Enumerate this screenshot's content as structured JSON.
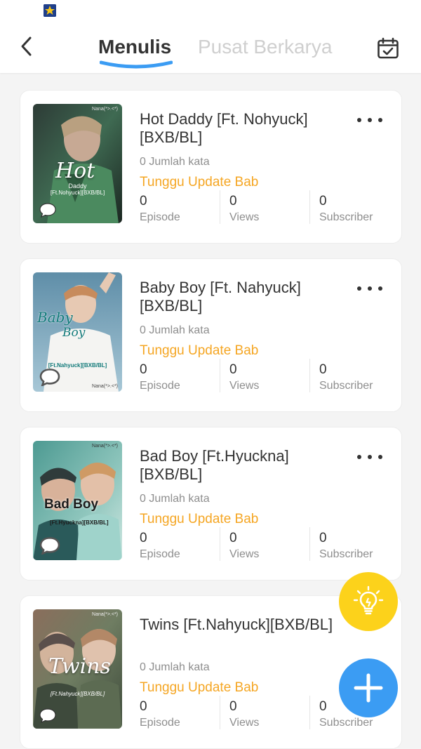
{
  "header": {
    "tab_active": "Menulis",
    "tab_inactive": "Pusat Berkarya"
  },
  "colors": {
    "accent_blue": "#3b9cf3",
    "status_orange": "#f5a623",
    "idea_yellow": "#fcd21b"
  },
  "icons": [
    "app-logo-icon",
    "back-arrow-icon",
    "calendar-check-icon",
    "more-dots-icon",
    "comment-icon",
    "lightbulb-icon",
    "plus-icon"
  ],
  "stat_labels": {
    "episode": "Episode",
    "views": "Views",
    "subscriber": "Subscriber"
  },
  "books": [
    {
      "title": "Hot Daddy [Ft. Nohyuck][BXB/BL]",
      "word_count": "0 Jumlah kata",
      "status": "Tunggu Update Bab",
      "episode": "0",
      "views": "0",
      "subscriber": "0",
      "cover_text": {
        "main": "Hot",
        "sub": "Daddy",
        "tag": "[Ft.Nohyuck][BXB/BL]",
        "credit": "Nana(*>.<*)"
      }
    },
    {
      "title": "Baby Boy [Ft. Nahyuck][BXB/BL]",
      "word_count": "0 Jumlah kata",
      "status": "Tunggu Update Bab",
      "episode": "0",
      "views": "0",
      "subscriber": "0",
      "cover_text": {
        "main": "Baby",
        "sub": "Boy",
        "tag": "[Ft.Nahyuck][BXB/BL]",
        "credit": "Nana(*>.<*)"
      }
    },
    {
      "title": "Bad Boy [Ft.Hyuckna][BXB/BL]",
      "word_count": "0 Jumlah kata",
      "status": "Tunggu Update Bab",
      "episode": "0",
      "views": "0",
      "subscriber": "0",
      "cover_text": {
        "main": "Bad Boy",
        "tag": "[Ft.Hyuckna][BXB/BL]",
        "credit": "Nana(*>.<*)"
      }
    },
    {
      "title": "Twins [Ft.Nahyuck][BXB/BL]",
      "word_count": "0 Jumlah kata",
      "status": "Tunggu Update Bab",
      "episode": "0",
      "views": "0",
      "subscriber": "0",
      "cover_text": {
        "main": "Twins",
        "tag": "[Ft.Nahyuck][BXB/BL]",
        "credit": "Nana(*>.<*)"
      }
    }
  ]
}
